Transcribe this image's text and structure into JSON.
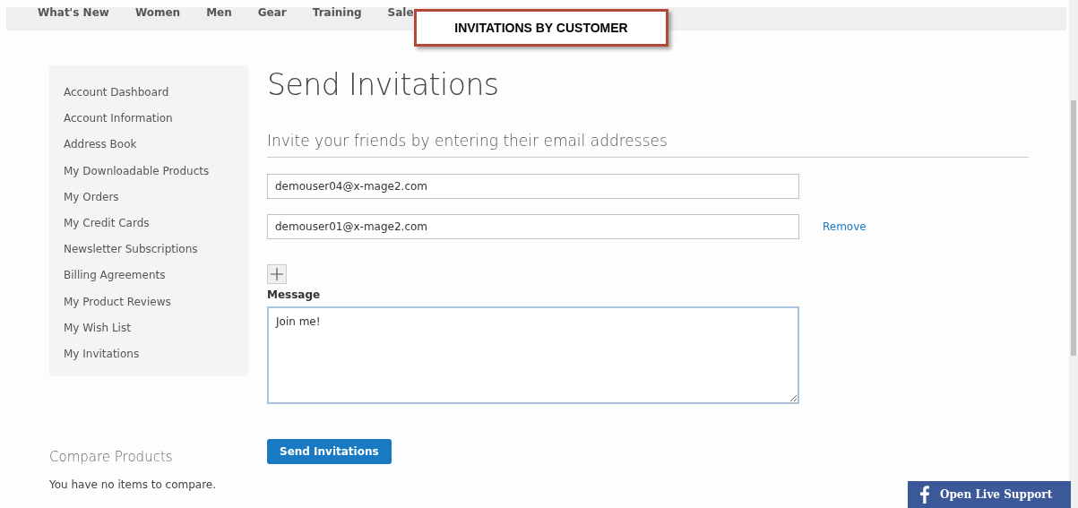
{
  "nav": {
    "items": [
      "What's New",
      "Women",
      "Men",
      "Gear",
      "Training",
      "Sale"
    ]
  },
  "callout": {
    "text": "INVITATIONS BY CUSTOMER"
  },
  "sidebar": {
    "items": [
      "Account Dashboard",
      "Account Information",
      "Address Book",
      "My Downloadable Products",
      "My Orders",
      "My Credit Cards",
      "Newsletter Subscriptions",
      "Billing Agreements",
      "My Product Reviews",
      "My Wish List",
      "My Invitations"
    ]
  },
  "compare": {
    "title": "Compare Products",
    "empty_text": "You have no items to compare."
  },
  "main": {
    "title": "Send Invitations",
    "subtitle": "Invite your friends by entering their email addresses",
    "emails": [
      {
        "value": "demouser04@x-mage2.com"
      },
      {
        "value": "demouser01@x-mage2.com",
        "remove_label": "Remove"
      }
    ],
    "message_label": "Message",
    "message": "Join me!",
    "submit": "Send Invitations"
  },
  "live_support": {
    "label": "Open Live Support"
  }
}
